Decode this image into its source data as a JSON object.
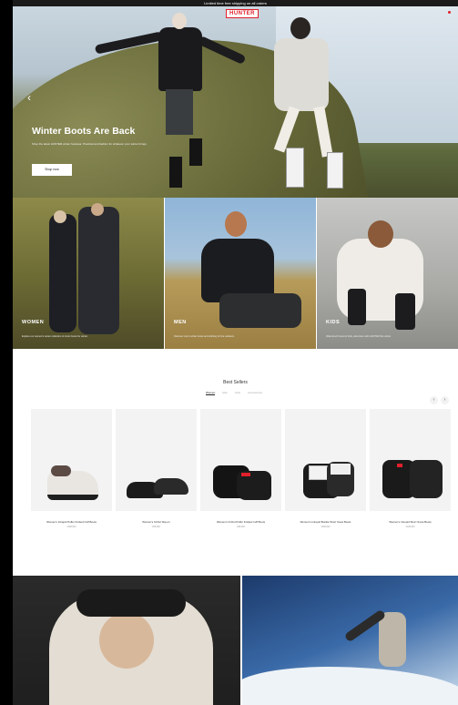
{
  "topbar": {
    "text": "Limited time free shipping on all orders"
  },
  "header": {
    "logo": "HUNTER",
    "brand_color": "#e0202a"
  },
  "hero": {
    "title": "Winter Boots Are Back",
    "subtitle": "Shop the latest HUNTER winter footwear. Practical and fashion for whatever your winter brings.",
    "cta": "Shop now"
  },
  "categories": [
    {
      "title": "WOMEN",
      "desc": "Explore our women's winter collection of iconic boots for winter."
    },
    {
      "title": "MEN",
      "desc": "Discover men's winter boots and clothing for the outdoors."
    },
    {
      "title": "KIDS",
      "desc": "Waterproof boots for kids, adventure with HUNTER this winter."
    }
  ],
  "best_sellers": {
    "title": "Best Sellers",
    "tabs": [
      "Women",
      "Men",
      "Kids",
      "Accessories"
    ],
    "products": [
      {
        "name": "Women's Intrepid Puffer Knitted Cuff Boots",
        "price": "¥198,000"
      },
      {
        "name": "Women's In/Out Slip-on",
        "price": "¥98,000"
      },
      {
        "name": "Women's In/Out Puffer Knitted Cuff Boots",
        "price": "¥98,000"
      },
      {
        "name": "Women's Intrepid Buckle Short Snow Boots",
        "price": "¥168,000"
      },
      {
        "name": "Women's Intrepid Short Snow Boots",
        "price": "¥138,000"
      }
    ]
  },
  "carousel": {
    "prev": "‹",
    "next": "›"
  }
}
